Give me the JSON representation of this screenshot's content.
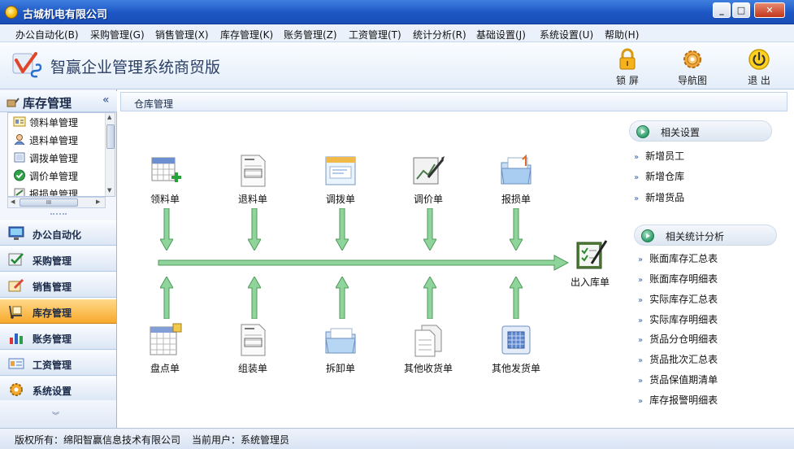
{
  "window": {
    "title": "古城机电有限公司",
    "min": "_",
    "max": "□",
    "close": "✕"
  },
  "menu": [
    "办公自动化(B)",
    "采购管理(G)",
    "销售管理(X)",
    "库存管理(K)",
    "账务管理(Z)",
    "工资管理(T)",
    "统计分析(R)",
    "基础设置(J)",
    "系统设置(U)",
    "帮助(H)"
  ],
  "banner": {
    "brand": "智赢企业管理系统商贸版"
  },
  "toolbar": {
    "lock": "锁 屏",
    "navigator": "导航图",
    "exit": "退 出"
  },
  "left": {
    "header": "库存管理",
    "collapse": "«",
    "subitems": [
      "领料单管理",
      "退料单管理",
      "调拨单管理",
      "调价单管理",
      "报损单管理"
    ],
    "scroll_mark": "III",
    "nav": [
      "办公自动化",
      "采购管理",
      "销售管理",
      "库存管理",
      "账务管理",
      "工资管理",
      "系统设置"
    ],
    "active": "库存管理"
  },
  "main": {
    "breadcrumb": "仓库管理",
    "top_nodes": [
      "领料单",
      "退料单",
      "调拨单",
      "调价单",
      "报损单"
    ],
    "bottom_nodes": [
      "盘点单",
      "组装单",
      "拆卸单",
      "其他收货单",
      "其他发货单"
    ],
    "target": "出入库单"
  },
  "right": {
    "settings_title": "相关设置",
    "settings": [
      "新增员工",
      "新增仓库",
      "新增货品"
    ],
    "stats_title": "相关统计分析",
    "stats": [
      "账面库存汇总表",
      "账面库存明细表",
      "实际库存汇总表",
      "实际库存明细表",
      "货品分仓明细表",
      "货品批次汇总表",
      "货品保值期清单",
      "库存报警明细表"
    ]
  },
  "status": {
    "copyright": "版权所有：绵阳智赢信息技术有限公司",
    "user": "当前用户：系统管理员"
  }
}
